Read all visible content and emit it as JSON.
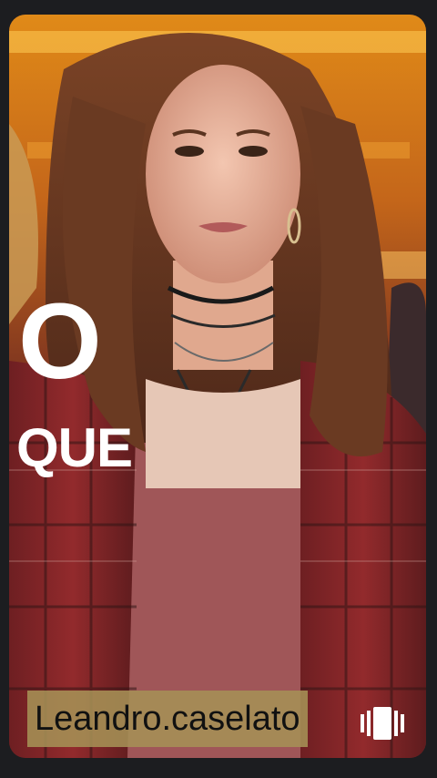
{
  "overlay": {
    "line1": "O",
    "line2": "QUE"
  },
  "user": {
    "username": "Leandro.caselato"
  },
  "icons": {
    "carousel": "multi-page-carousel-icon"
  },
  "colors": {
    "background": "#1c1d20",
    "tag_background": "#a59155"
  }
}
